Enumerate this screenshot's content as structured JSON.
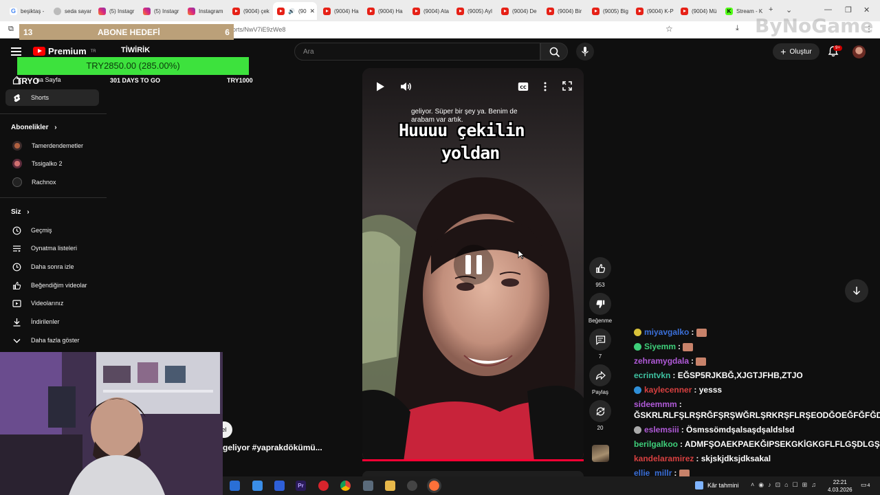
{
  "browser": {
    "tabs": [
      {
        "label": "beşiktaş -",
        "icon": "google-icon",
        "active": false
      },
      {
        "label": "seda sayar",
        "icon": "generic-icon",
        "active": false
      },
      {
        "label": "(5) Instagr",
        "icon": "instagram-icon",
        "active": false
      },
      {
        "label": "(5) Instagr",
        "icon": "instagram-icon",
        "active": false
      },
      {
        "label": "Instagram",
        "icon": "instagram-icon",
        "active": false
      },
      {
        "label": "(9004) çek",
        "icon": "youtube-icon",
        "active": false
      },
      {
        "label": "(90",
        "icon": "youtube-icon",
        "active": true
      },
      {
        "label": "(9004) Ha",
        "icon": "youtube-icon",
        "active": false
      },
      {
        "label": "(9004) Ha",
        "icon": "youtube-icon",
        "active": false
      },
      {
        "label": "(9004) Ata",
        "icon": "youtube-icon",
        "active": false
      },
      {
        "label": "(9005) Ayl",
        "icon": "youtube-icon",
        "active": false
      },
      {
        "label": "(9004) De",
        "icon": "youtube-icon",
        "active": false
      },
      {
        "label": "(9004) Bir",
        "icon": "youtube-icon",
        "active": false
      },
      {
        "label": "(9005) Big",
        "icon": "youtube-icon",
        "active": false
      },
      {
        "label": "(9004) K-P",
        "icon": "youtube-icon",
        "active": false
      },
      {
        "label": "(9004) Mü",
        "icon": "youtube-icon",
        "active": false
      },
      {
        "label": "Stream - K",
        "icon": "kick-icon",
        "active": false
      }
    ],
    "new_tab": "+",
    "url": "orts/NwV7iE9zWe8",
    "watermark": "ByNoGame"
  },
  "overlay": {
    "abone_left": "13",
    "abone_title": "ABONE HEDEFİ",
    "abone_right": "6",
    "tiwirik": "TİWİRİK",
    "goal_amount": "TRY2850.00 (285.00%)",
    "goal_left": "TRYO",
    "days_to_go": "301 DAYS TO GO",
    "goal_target": "TRY1000"
  },
  "header": {
    "logo_word": "Premium",
    "logo_region": "TR",
    "search_placeholder": "Ara",
    "create_label": "Oluştur",
    "notifications": "9+"
  },
  "sidebar": {
    "home_label": "na Sayfa",
    "shorts_label": "Shorts",
    "subscriptions_title": "Abonelikler",
    "subscriptions": [
      "Tamerdendemetler",
      "Tssigalko 2",
      "Rachnox"
    ],
    "you_title": "Siz",
    "you_items": [
      "Geçmiş",
      "Oynatma listeleri",
      "Daha sonra izle",
      "Beğendiğim videolar",
      "Videolarınız",
      "İndirilenler",
      "Daha fazla göster"
    ]
  },
  "video": {
    "caption_small": "geliyor. Süper bir şey ya. Benim de\narabam var artık.",
    "caption_line1": "Huuuu çekilin",
    "caption_line2": "yoldan",
    "left_title": "geliyor #yaprakdökümü...",
    "left_bubble": "el"
  },
  "actions": {
    "likes": "953",
    "dislike_label": "Beğenme",
    "comments": "7",
    "share_label": "Paylaş",
    "remix": "20"
  },
  "chat": [
    {
      "user": "miyavgalko",
      "color": "#3a6fd8",
      "msg": "",
      "emote": true,
      "badge": "#d8c23a"
    },
    {
      "user": "Siyemm",
      "color": "#3ecf7a",
      "msg": "",
      "emote": true,
      "badge": "#3ecf7a"
    },
    {
      "user": "zehramygdala",
      "color": "#b05ad8",
      "msg": "",
      "emote": true,
      "badge": ""
    },
    {
      "user": "ecrintvkn",
      "color": "#3ec1a0",
      "msg": "EĞSP5RJKBĞ,XJGTJFHB,ZTJO",
      "emote": false,
      "badge": ""
    },
    {
      "user": "kaylecenner",
      "color": "#d84040",
      "msg": "yesss",
      "emote": false,
      "badge": "#2f8fd8"
    },
    {
      "user": "sideemmm",
      "color": "#b05ad8",
      "msg": "",
      "emote": false,
      "badge": ""
    },
    {
      "user": "",
      "color": "#fff",
      "msg": "ĞSKRLRLFŞLRŞRĞFŞRŞWĞRLŞRKRŞFLRŞEODĞOEĞFĞFĞD",
      "emote": false,
      "badge": ""
    },
    {
      "user": "eslemsiii",
      "color": "#b05ad8",
      "msg": "Ösmssömdşalsaşdşaldslsd",
      "emote": false,
      "badge": "#aaaaaa"
    },
    {
      "user": "berilgalkoo",
      "color": "#3ecf7a",
      "msg": "ADMFŞOAEKPAEKĞIPSEKGKİGKGFLFLGŞDLGŞD",
      "emote": false,
      "badge": ""
    },
    {
      "user": "kandelaramirez",
      "color": "#d84040",
      "msg": "skjskjdksjdksakal",
      "emote": false,
      "badge": ""
    },
    {
      "user": "ellie_millr",
      "color": "#3a6fd8",
      "msg": "",
      "emote": true,
      "badge": ""
    }
  ],
  "taskbar": {
    "weather": "Kâr tahmini",
    "time": "22:21",
    "date": "4.03.2026",
    "notif": "4"
  }
}
